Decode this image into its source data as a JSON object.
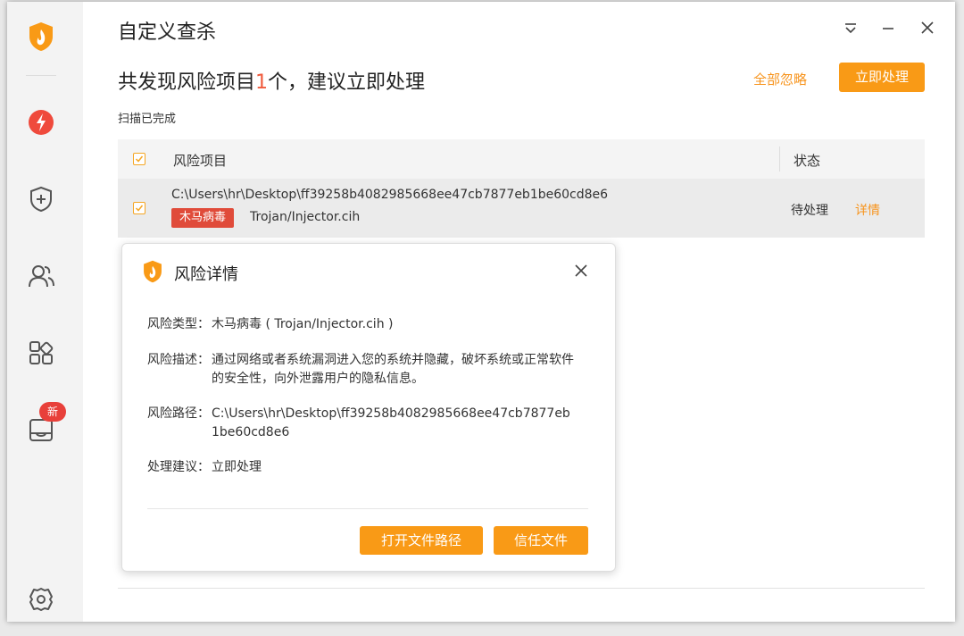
{
  "window": {
    "title": "自定义查杀"
  },
  "summary": {
    "headline_prefix": "共发现风险项目",
    "count": "1",
    "headline_suffix": "个，建议立即处理",
    "ignore_all_label": "全部忽略",
    "handle_now_label": "立即处理",
    "scan_status": "扫描已完成"
  },
  "table": {
    "columns": [
      "风险项目",
      "状态"
    ],
    "rows": [
      {
        "path": "C:\\Users\\hr\\Desktop\\ff39258b4082985668ee47cb7877eb1be60cd8e6",
        "tag": "木马病毒",
        "file": "Trojan/Injector.cih",
        "status": "待处理",
        "action": "详情"
      }
    ]
  },
  "sidebar": {
    "items": [
      "logo-icon",
      "bolt-icon",
      "shield-plus-icon",
      "users-icon",
      "apps-icon",
      "box-icon",
      "settings-icon"
    ],
    "new_badge": "新"
  },
  "dialog": {
    "title": "风险详情",
    "fields": [
      {
        "label": "风险类型：",
        "value": "木马病毒 ( Trojan/Injector.cih )"
      },
      {
        "label": "风险描述：",
        "value": "通过网络或者系统漏洞进入您的系统并隐藏，破坏系统或正常软件的安全性，向外泄露用户的隐私信息。"
      },
      {
        "label": "风险路径：",
        "value": "C:\\Users\\hr\\Desktop\\ff39258b4082985668ee47cb7877eb1be60cd8e6"
      },
      {
        "label": "处理建议：",
        "value": "立即处理"
      }
    ],
    "open_path_label": "打开文件路径",
    "trust_label": "信任文件"
  },
  "colors": {
    "accent": "#f99a16",
    "danger": "#e04b3a",
    "link": "#f7941d"
  }
}
